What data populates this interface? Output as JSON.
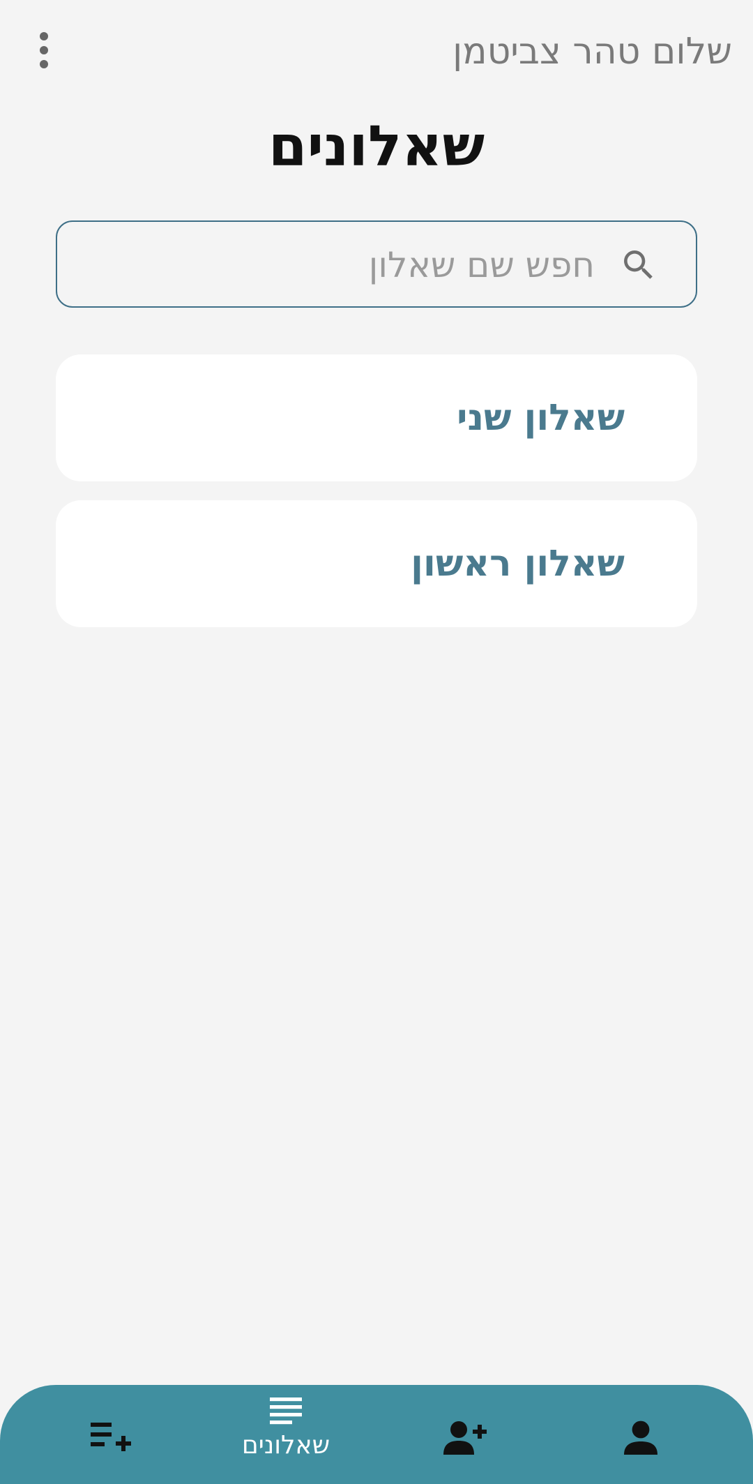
{
  "header": {
    "greeting": "שלום טהר צביטמן",
    "menu_icon": "more-vert-icon"
  },
  "page": {
    "title": "שאלונים"
  },
  "search": {
    "placeholder": "חפש שם שאלון",
    "value": "",
    "icon": "search-icon"
  },
  "questionnaires": [
    {
      "label": "שאלון שני"
    },
    {
      "label": "שאלון ראשון"
    }
  ],
  "bottom_nav": {
    "items": [
      {
        "icon": "add-questionnaire-icon",
        "label": ""
      },
      {
        "icon": "questionnaires-list-icon",
        "label": "שאלונים",
        "active": true
      },
      {
        "icon": "add-user-icon",
        "label": ""
      },
      {
        "icon": "profile-icon",
        "label": ""
      }
    ]
  },
  "colors": {
    "background": "#f4f4f4",
    "accent": "#408fa0",
    "card_text": "#4a7a8e",
    "search_border": "#3e6f87"
  }
}
